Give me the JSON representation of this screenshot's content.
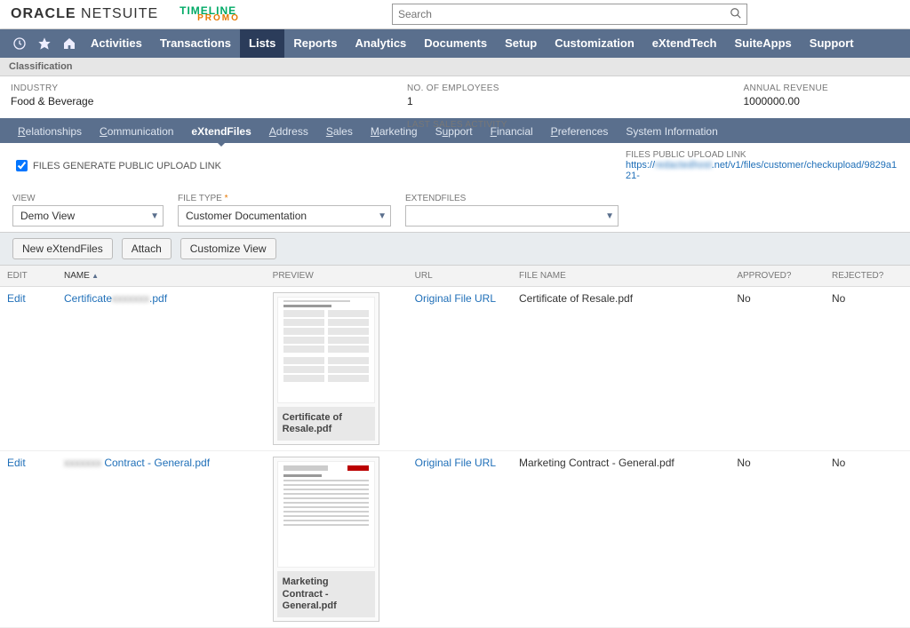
{
  "header": {
    "logo1": "ORACLE NETSUITE",
    "logo2_top": "TIMELINE",
    "logo2_bottom": "PROMO",
    "search_placeholder": "Search"
  },
  "nav": {
    "items": [
      "Activities",
      "Transactions",
      "Lists",
      "Reports",
      "Analytics",
      "Documents",
      "Setup",
      "Customization",
      "eXtendTech",
      "SuiteApps",
      "Support"
    ],
    "active_index": 2
  },
  "classification": {
    "title": "Classification",
    "industry_label": "INDUSTRY",
    "industry_value": "Food & Beverage",
    "employees_label": "NO. OF EMPLOYEES",
    "employees_value": "1",
    "last_sales_label": "LAST SALES ACTIVITY",
    "last_sales_value": "",
    "revenue_label": "ANNUAL REVENUE",
    "revenue_value": "1000000.00"
  },
  "subtabs": {
    "items": [
      {
        "label": "Relationships",
        "key": "R"
      },
      {
        "label": "Communication",
        "key": "C"
      },
      {
        "label": "eXtendFiles",
        "key": ""
      },
      {
        "label": "Address",
        "key": "A"
      },
      {
        "label": "Sales",
        "key": "S"
      },
      {
        "label": "Marketing",
        "key": "M"
      },
      {
        "label": "Support",
        "key": "S"
      },
      {
        "label": "Financial",
        "key": "F"
      },
      {
        "label": "Preferences",
        "key": "P"
      },
      {
        "label": "System Information",
        "key": ""
      }
    ],
    "active_index": 2
  },
  "upload": {
    "checkbox_label": "FILES GENERATE PUBLIC UPLOAD LINK",
    "right_label": "FILES PUBLIC UPLOAD LINK",
    "link_prefix": "https://",
    "link_suffix": ".net/v1/files/customer/checkupload/9829a121-"
  },
  "filters": {
    "view_label": "VIEW",
    "view_value": "Demo View",
    "filetype_label": "FILE TYPE",
    "filetype_value": "Customer Documentation",
    "extendfiles_label": "EXTENDFILES",
    "extendfiles_value": ""
  },
  "actions": {
    "new": "New eXtendFiles",
    "attach": "Attach",
    "customize": "Customize View"
  },
  "table": {
    "headers": {
      "edit": "EDIT",
      "name": "NAME",
      "preview": "PREVIEW",
      "url": "URL",
      "filename": "FILE NAME",
      "approved": "APPROVED?",
      "rejected": "REJECTED?"
    },
    "rows": [
      {
        "edit": "Edit",
        "name_prefix": "Certificate",
        "name_blur": "xxxxxxx",
        "name_suffix": ".pdf",
        "preview_caption": "Certificate of Resale.pdf",
        "url": "Original File URL",
        "filename": "Certificate of Resale.pdf",
        "approved": "No",
        "rejected": "No"
      },
      {
        "edit": "Edit",
        "name_prefix": "",
        "name_blur": "xxxxxxx",
        "name_suffix": "Contract - General.pdf",
        "preview_caption": "Marketing Contract - General.pdf",
        "url": "Original File URL",
        "filename": "Marketing Contract - General.pdf",
        "approved": "No",
        "rejected": "No"
      }
    ]
  }
}
